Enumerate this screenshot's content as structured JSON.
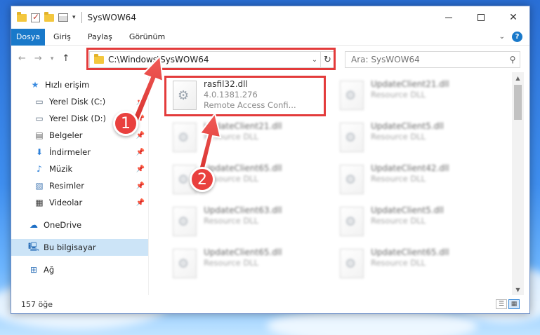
{
  "window": {
    "title": "SysWOW64",
    "quick_access": [
      "folder-icon",
      "checkbox-icon",
      "properties-icon",
      "dropdown-icon"
    ]
  },
  "ribbon": {
    "file_tab": "Dosya",
    "tabs": [
      "Giriş",
      "Paylaş",
      "Görünüm"
    ]
  },
  "address": {
    "path": "C:\\Windows\\SysWOW64",
    "search_placeholder": "Ara: SysWOW64"
  },
  "sidebar": {
    "items": [
      {
        "label": "Hızlı erişim",
        "icon": "star-icon",
        "pinned": false
      },
      {
        "label": "Yerel Disk (C:)",
        "icon": "drive-icon",
        "pinned": true
      },
      {
        "label": "Yerel Disk (D:)",
        "icon": "drive-icon",
        "pinned": true
      },
      {
        "label": "Belgeler",
        "icon": "document-icon",
        "pinned": true
      },
      {
        "label": "İndirmeler",
        "icon": "download-icon",
        "pinned": true
      },
      {
        "label": "Müzik",
        "icon": "music-icon",
        "pinned": true
      },
      {
        "label": "Resimler",
        "icon": "pictures-icon",
        "pinned": true
      },
      {
        "label": "Videolar",
        "icon": "video-icon",
        "pinned": true
      },
      {
        "label": "OneDrive",
        "icon": "cloud-icon",
        "pinned": false
      },
      {
        "label": "Bu bilgisayar",
        "icon": "computer-icon",
        "pinned": false,
        "selected": true
      },
      {
        "label": "Ağ",
        "icon": "network-icon",
        "pinned": false
      }
    ]
  },
  "files": [
    {
      "name": "rasfil32.dll",
      "version": "4.0.1381.276",
      "desc": "Remote Access Confi...",
      "highlight": true
    },
    {
      "name": "UpdateClient21.dll",
      "desc": "Resource DLL"
    },
    {
      "name": "UpdateClient21.dll",
      "desc": "Resource DLL"
    },
    {
      "name": "UpdateClient5.dll",
      "desc": "Resource DLL"
    },
    {
      "name": "UpdateClient65.dll",
      "desc": "Resource DLL"
    },
    {
      "name": "UpdateClient42.dll",
      "desc": "Resource DLL"
    },
    {
      "name": "UpdateClient63.dll",
      "desc": "Resource DLL"
    },
    {
      "name": "UpdateClient5.dll",
      "desc": "Resource DLL"
    },
    {
      "name": "UpdateClient65.dll",
      "desc": "Resource DLL"
    },
    {
      "name": "UpdateClient65.dll",
      "desc": "Resource DLL"
    }
  ],
  "status": {
    "item_count": "157 öğe"
  },
  "annotations": {
    "step1": "1",
    "step2": "2",
    "highlight_color": "#e33b3b"
  },
  "colors": {
    "accent": "#1979ca",
    "selected_bg": "#cce4f7"
  }
}
